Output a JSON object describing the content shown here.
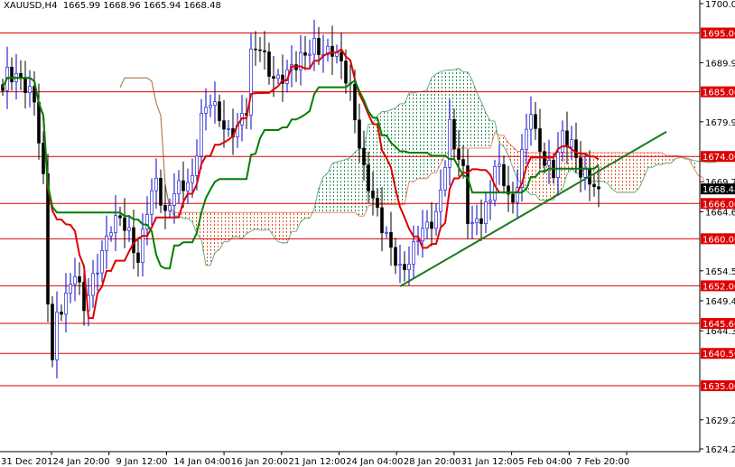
{
  "header": {
    "symbol": "XAUUSD,H4",
    "open": "1665.99",
    "high": "1668.96",
    "low": "1665.94",
    "close": "1668.48"
  },
  "chart_data": {
    "type": "candlestick",
    "title": "XAUUSD,H4",
    "ylim": [
      1624.25,
      1700.0
    ],
    "y_ticks": [
      "1700.00",
      "1689.95",
      "1679.90",
      "1669.70",
      "1664.60",
      "1654.55",
      "1649.45",
      "1644.35",
      "1629.20",
      "1624.25"
    ],
    "x_ticks": [
      "31 Dec 2012",
      "4 Jan 20:00",
      "9 Jan 12:00",
      "14 Jan 04:00",
      "16 Jan 20:00",
      "21 Jan 12:00",
      "24 Jan 04:00",
      "28 Jan 20:00",
      "31 Jan 12:00",
      "5 Feb 04:00",
      "7 Feb 20:00"
    ],
    "close_path": [
      [
        0,
        1685.2
      ],
      [
        1,
        1688.3
      ],
      [
        4,
        1687
      ],
      [
        7,
        1683.7
      ],
      [
        9,
        1669.9
      ],
      [
        10,
        1649.9
      ],
      [
        11,
        1639.2
      ],
      [
        12,
        1646.8
      ],
      [
        14,
        1649.9
      ],
      [
        16,
        1654.5
      ],
      [
        18,
        1648.4
      ],
      [
        20,
        1653.0
      ],
      [
        22,
        1657.6
      ],
      [
        24,
        1662.2
      ],
      [
        26,
        1663.7
      ],
      [
        28,
        1660.7
      ],
      [
        30,
        1656.1
      ],
      [
        32,
        1665.3
      ],
      [
        34,
        1669.9
      ],
      [
        36,
        1663.7
      ],
      [
        38,
        1668.3
      ],
      [
        42,
        1669.9
      ],
      [
        44,
        1680.6
      ],
      [
        46,
        1683.7
      ],
      [
        48,
        1680.6
      ],
      [
        50,
        1677.6
      ],
      [
        52,
        1679.1
      ],
      [
        54,
        1682.2
      ],
      [
        55,
        1691.4
      ],
      [
        57,
        1692.9
      ],
      [
        59,
        1688.3
      ],
      [
        61,
        1686.8
      ],
      [
        63,
        1688.3
      ],
      [
        65,
        1689.9
      ],
      [
        67,
        1691.4
      ],
      [
        69,
        1692.9
      ],
      [
        71,
        1691.4
      ],
      [
        73,
        1692.2
      ],
      [
        75,
        1689.9
      ],
      [
        77,
        1685.2
      ],
      [
        78,
        1680.6
      ],
      [
        79,
        1676.0
      ],
      [
        80,
        1671.4
      ],
      [
        82,
        1666.8
      ],
      [
        84,
        1662.2
      ],
      [
        86,
        1658.4
      ],
      [
        88,
        1654.5
      ],
      [
        90,
        1656.1
      ],
      [
        92,
        1660.7
      ],
      [
        94,
        1662.2
      ],
      [
        96,
        1663.7
      ],
      [
        98,
        1673.0
      ],
      [
        99,
        1679.1
      ],
      [
        100,
        1676.0
      ],
      [
        102,
        1671.4
      ],
      [
        103,
        1663.7
      ],
      [
        104,
        1662.2
      ],
      [
        106,
        1663.7
      ],
      [
        108,
        1666.8
      ],
      [
        109,
        1673.0
      ],
      [
        111,
        1669.9
      ],
      [
        113,
        1665.3
      ],
      [
        115,
        1674.5
      ],
      [
        117,
        1682.2
      ],
      [
        118,
        1677.6
      ],
      [
        120,
        1673.0
      ],
      [
        122,
        1671.4
      ],
      [
        124,
        1677.6
      ],
      [
        126,
        1676.0
      ],
      [
        128,
        1671.4
      ],
      [
        130,
        1669.9
      ],
      [
        132,
        1668.48
      ]
    ],
    "levels": [
      {
        "price": 1695.0,
        "label": "1695.00"
      },
      {
        "price": 1685.0,
        "label": "1685.00"
      },
      {
        "price": 1674.0,
        "label": "1674.00"
      },
      {
        "price": 1666.0,
        "label": "1666.00"
      },
      {
        "price": 1660.0,
        "label": "1660.00"
      },
      {
        "price": 1652.0,
        "label": "1652.00"
      },
      {
        "price": 1645.6,
        "label": "1645.60"
      },
      {
        "price": 1640.5,
        "label": "1640.50"
      },
      {
        "price": 1635.0,
        "label": "1635.00"
      }
    ],
    "current_price": {
      "price": 1668.48,
      "label": "1668.48"
    },
    "trendline": {
      "from": [
        88,
        1651.9
      ],
      "to": [
        147,
        1678.2
      ]
    },
    "colors": {
      "up": "#0000cc",
      "down": "#000000",
      "level": "#dd0000",
      "tenkan": "#dd0000",
      "kijun": "#008000",
      "trend": "#1a7a1a",
      "cloud_bull": "#2e8b57",
      "cloud_bear": "#dd5522"
    }
  }
}
